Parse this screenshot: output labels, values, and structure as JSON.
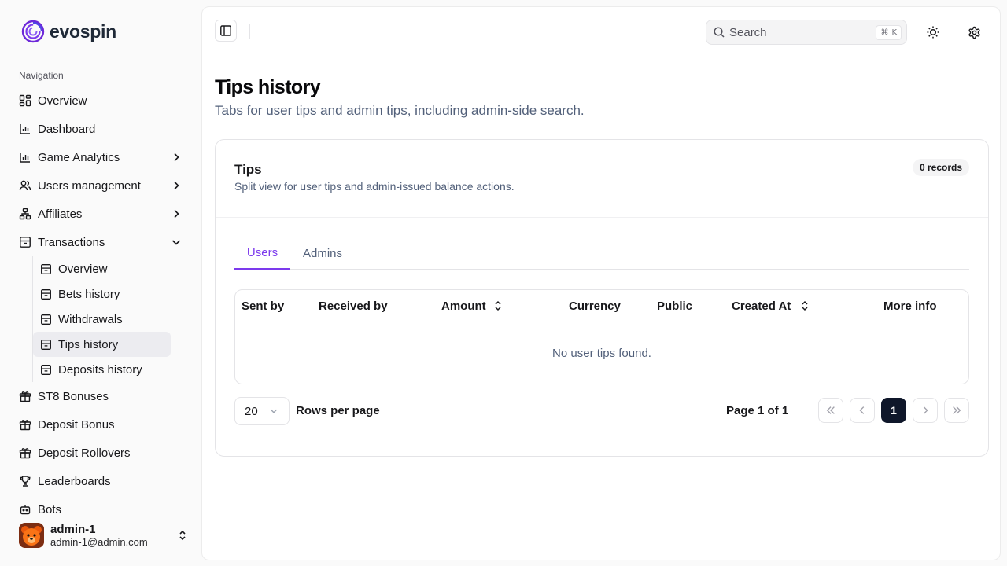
{
  "app": {
    "name": "evospin"
  },
  "sidebar": {
    "heading": "Navigation",
    "items": [
      {
        "label": "Overview",
        "icon": "layout-grid-icon"
      },
      {
        "label": "Dashboard",
        "icon": "bar-chart-icon"
      },
      {
        "label": "Game Analytics",
        "icon": "bar-chart-icon",
        "expandable": true
      },
      {
        "label": "Users management",
        "icon": "users-icon",
        "expandable": true
      },
      {
        "label": "Affiliates",
        "icon": "network-icon",
        "expandable": true
      },
      {
        "label": "Transactions",
        "icon": "archive-icon",
        "expanded": true
      }
    ],
    "transactions_children": [
      {
        "label": "Overview"
      },
      {
        "label": "Bets history"
      },
      {
        "label": "Withdrawals"
      },
      {
        "label": "Tips history",
        "active": true
      },
      {
        "label": "Deposits history"
      }
    ],
    "items_after": [
      {
        "label": "ST8 Bonuses",
        "icon": "gift-icon"
      },
      {
        "label": "Deposit Bonus",
        "icon": "gift-icon"
      },
      {
        "label": "Deposit Rollovers",
        "icon": "gift-icon"
      },
      {
        "label": "Leaderboards",
        "icon": "trophy-icon"
      },
      {
        "label": "Bots",
        "icon": "bot-icon"
      }
    ],
    "user": {
      "name": "admin-1",
      "email": "admin-1@admin.com"
    }
  },
  "header": {
    "search_placeholder": "Search",
    "shortcut_key": "K",
    "shortcut_mod": "⌘"
  },
  "page": {
    "title": "Tips history",
    "subtitle": "Tabs for user tips and admin tips, including admin-side search."
  },
  "card": {
    "title": "Tips",
    "subtitle": "Split view for user tips and admin-issued balance actions.",
    "badge": "0 records",
    "tabs": [
      {
        "label": "Users",
        "active": true
      },
      {
        "label": "Admins",
        "active": false
      }
    ],
    "columns": [
      "Sent by",
      "Received by",
      "Amount",
      "Currency",
      "Public",
      "Created At",
      "More info"
    ],
    "empty_message": "No user tips found.",
    "pagination": {
      "rows_per_page_value": "20",
      "rows_per_page_label": "Rows per page",
      "page_label": "Page 1 of 1",
      "current_page": "1"
    }
  },
  "colors": {
    "accent": "#7c3aed",
    "current_page_bg": "#0f172a"
  }
}
